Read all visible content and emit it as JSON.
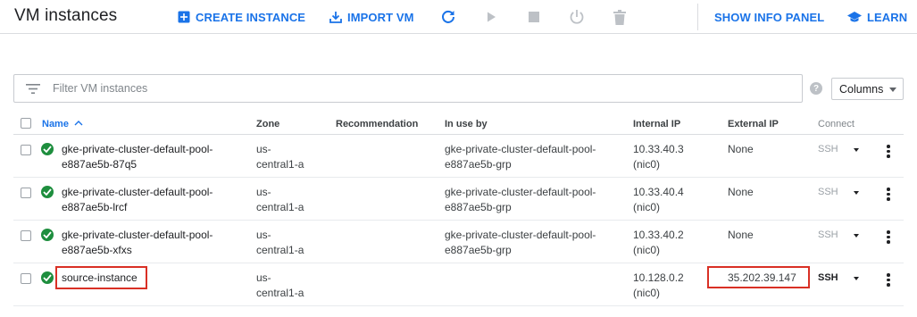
{
  "header": {
    "title": "VM instances",
    "create_label": "CREATE INSTANCE",
    "import_label": "IMPORT VM",
    "info_panel_label": "SHOW INFO PANEL",
    "learn_label": "LEARN"
  },
  "filter": {
    "placeholder": "Filter VM instances",
    "help_glyph": "?",
    "columns_label": "Columns"
  },
  "table": {
    "headers": {
      "name": "Name",
      "zone": "Zone",
      "recommendation": "Recommendation",
      "in_use_by": "In use by",
      "internal_ip": "Internal IP",
      "external_ip": "External IP",
      "connect": "Connect"
    },
    "rows": [
      {
        "name_l1": "gke-private-cluster-default-pool-",
        "name_l2": "e887ae5b-87q5",
        "zone_l1": "us-",
        "zone_l2": "central1-a",
        "in_use_l1": "gke-private-cluster-default-pool-",
        "in_use_l2": "e887ae5b-grp",
        "internal_l1": "10.33.40.3",
        "internal_l2": "(nic0)",
        "external": "None",
        "connect": "SSH"
      },
      {
        "name_l1": "gke-private-cluster-default-pool-",
        "name_l2": "e887ae5b-lrcf",
        "zone_l1": "us-",
        "zone_l2": "central1-a",
        "in_use_l1": "gke-private-cluster-default-pool-",
        "in_use_l2": "e887ae5b-grp",
        "internal_l1": "10.33.40.4",
        "internal_l2": "(nic0)",
        "external": "None",
        "connect": "SSH"
      },
      {
        "name_l1": "gke-private-cluster-default-pool-",
        "name_l2": "e887ae5b-xfxs",
        "zone_l1": "us-",
        "zone_l2": "central1-a",
        "in_use_l1": "gke-private-cluster-default-pool-",
        "in_use_l2": "e887ae5b-grp",
        "internal_l1": "10.33.40.2",
        "internal_l2": "(nic0)",
        "external": "None",
        "connect": "SSH"
      },
      {
        "name_l1": "source-instance",
        "name_l2": "",
        "zone_l1": "us-",
        "zone_l2": "central1-a",
        "in_use_l1": "",
        "in_use_l2": "",
        "internal_l1": "10.128.0.2",
        "internal_l2": "(nic0)",
        "external": "35.202.39.147",
        "connect": "SSH"
      }
    ]
  },
  "colors": {
    "accent": "#1a73e8",
    "running_status": "#1e8e3e",
    "highlight": "#d93025"
  },
  "icons": {
    "create": "add-box-icon",
    "import": "download-icon",
    "refresh": "refresh-icon",
    "start": "play-icon",
    "stop": "stop-icon",
    "reset": "power-icon",
    "delete": "trash-icon",
    "learn": "school-icon",
    "filter": "filter-list-icon",
    "status": "check-circle-icon",
    "row_menu": "more-vert-icon"
  }
}
